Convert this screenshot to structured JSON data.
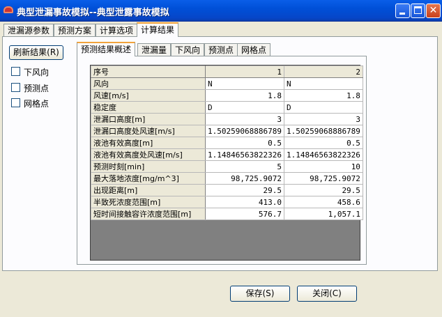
{
  "window": {
    "title": "典型泄漏事故模拟--典型泄露事故模拟"
  },
  "outer_tabs": [
    "泄漏源参数",
    "预测方案",
    "计算选项",
    "计算结果"
  ],
  "left_panel": {
    "refresh_label": "刷新结果(R)",
    "checkboxes": [
      "下风向",
      "预测点",
      "网格点"
    ]
  },
  "inner_tabs": [
    "预测结果概述",
    "泄漏量",
    "下风向",
    "预测点",
    "网格点"
  ],
  "grid": {
    "header": [
      "序号",
      "1",
      "2"
    ],
    "rows": [
      [
        "风向",
        "N",
        "N"
      ],
      [
        "风速[m/s]",
        "1.8",
        "1.8"
      ],
      [
        "稳定度",
        "D",
        "D"
      ],
      [
        "泄漏口高度[m]",
        "3",
        "3"
      ],
      [
        "泄漏口高度处风速[m/s]",
        "1.50259068886789",
        "1.50259068886789"
      ],
      [
        "液池有效高度[m]",
        "0.5",
        "0.5"
      ],
      [
        "液池有效高度处风速[m/s]",
        "1.14846563822326",
        "1.14846563822326"
      ],
      [
        "预测时刻[min]",
        "5",
        "10"
      ],
      [
        "最大落地浓度[mg/m^3]",
        "98,725.9072",
        "98,725.9072"
      ],
      [
        "出现距离[m]",
        "29.5",
        "29.5"
      ],
      [
        "半致死浓度范围[m]",
        "413.0",
        "458.6"
      ],
      [
        "短时间接触容许浓度范围[m]",
        "576.7",
        "1,057.1"
      ]
    ]
  },
  "buttons": {
    "save": "保存(S)",
    "close": "关闭(C)"
  }
}
